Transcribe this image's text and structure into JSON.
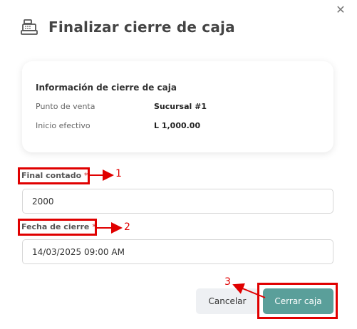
{
  "dialog": {
    "title": "Finalizar cierre de caja",
    "close_glyph": "✕"
  },
  "summary": {
    "heading": "Información de cierre de caja",
    "rows": [
      {
        "label": "Punto de venta",
        "value": "Sucursal #1"
      },
      {
        "label": "Inicio efectivo",
        "value": "L 1,000.00"
      }
    ]
  },
  "form": {
    "final_count": {
      "label": "Final contado",
      "required_mark": "*",
      "value": "2000"
    },
    "close_date": {
      "label": "Fecha de cierre",
      "required_mark": "*",
      "value": "14/03/2025 09:00 AM"
    }
  },
  "buttons": {
    "cancel": "Cancelar",
    "submit": "Cerrar caja"
  },
  "annotations": {
    "marker_1": "1",
    "marker_2": "2",
    "marker_3": "3",
    "color": "#e00000"
  },
  "colors": {
    "primary_button": "#5a9f9a",
    "secondary_button": "#eef0f3"
  },
  "icons": {
    "title_icon": "cash-register-icon",
    "close_icon": "close-icon"
  }
}
